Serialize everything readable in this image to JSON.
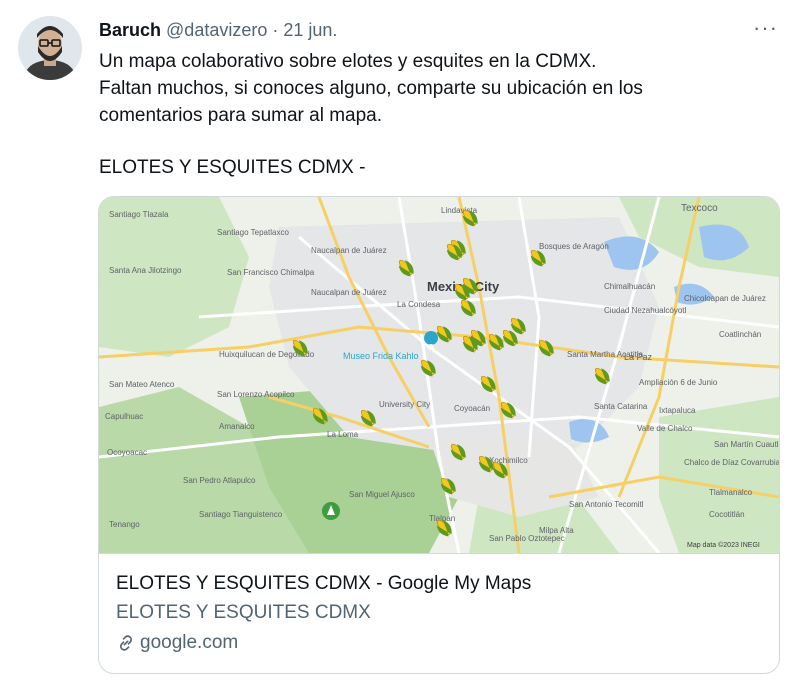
{
  "tweet": {
    "author_name": "Baruch",
    "author_handle": "@datavizero",
    "separator": "·",
    "date": "21 jun.",
    "more": "···",
    "lines": [
      "Un mapa colaborativo sobre elotes y esquites en la CDMX.",
      "Faltan muchos, si conoces alguno, comparte su ubicación en los",
      "comentarios para sumar al mapa."
    ],
    "link_text": "ELOTES Y ESQUITES CDMX -"
  },
  "card": {
    "title": "ELOTES Y ESQUITES CDMX - Google My Maps",
    "description": "ELOTES Y ESQUITES CDMX",
    "domain": "google.com",
    "domain_icon": "link-icon"
  },
  "map": {
    "main_label": "Mexico City",
    "museum_label": "Museo Frida Kahlo",
    "attribution": "Map data ©2023 INEGI",
    "place_labels": [
      "Texcoco",
      "Lindavista",
      "Bosques de Aragón",
      "Naucalpan de Juárez",
      "Naucalpan de Juárez",
      "Chimalhuacán",
      "Ciudad Nezahualcóyotl",
      "La Condesa",
      "Huixquilucan de Degollado",
      "La Paz",
      "University City",
      "Coyoacán",
      "Ampliación 6 de Junio",
      "Valle de Chalco",
      "Chalco de Díaz Covarrubias",
      "Xochimilco",
      "San Miguel Ajusco",
      "Tlalpan",
      "La Loma",
      "Santa Martha Acatitla",
      "San Pedro Atlapulco",
      "Santiago Tepatlaxco",
      "San Francisco Chimalpa",
      "Ocoyoacac",
      "San Pablo Oztotepec",
      "Milpa Alta",
      "San Antonio Tecomitl",
      "Tlalmanalco",
      "San Martín Cuautlalpan",
      "Ixtapaluca",
      "Santa Catarina",
      "Coatlinchán",
      "Chicoloapan de Juárez",
      "Capulhuac",
      "Cocotitlán",
      "Santiago Tlazala",
      "Santa Ana Jilotzingo",
      "San Mateo Atenco",
      "Tenango",
      "Santiago Tianguistenco",
      "Amanalco",
      "San Lorenzo Acopilco"
    ],
    "marker_count_label": "",
    "colors": {
      "land": "#eef0ea",
      "urban": "#e4e6e8",
      "green": "#cfe6c2",
      "forest": "#b9d9a8",
      "water": "#9ec4f0",
      "highway": "#f6cf65",
      "road": "#ffffff",
      "marker_yellow": "#f3c81b",
      "marker_green": "#5e9a1f"
    }
  }
}
